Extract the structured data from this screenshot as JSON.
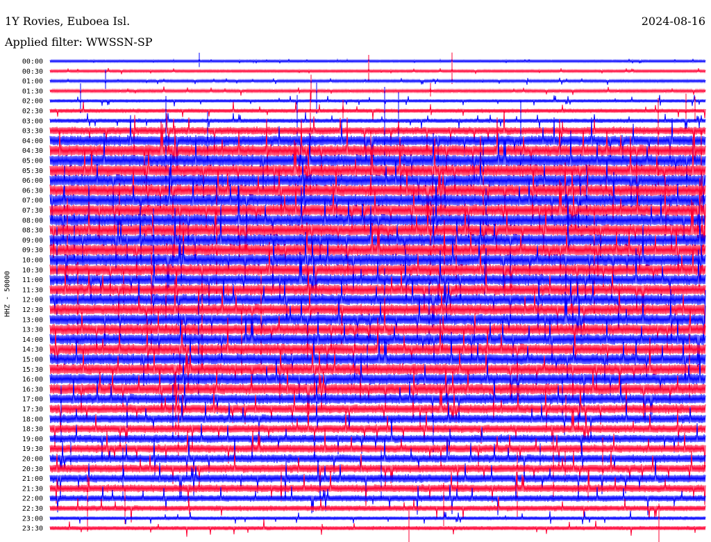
{
  "header": {
    "station": "1Y Rovies, Euboea Isl.",
    "date": "2024-08-16",
    "filter": "Applied filter: WWSSN-SP"
  },
  "chart_data": {
    "type": "helicorder",
    "title": "1Y Rovies, Euboea Isl.",
    "date": "2024-08-16",
    "filter": "WWSSN-SP",
    "ylabel": "HHZ - 50000",
    "row_interval_minutes": 30,
    "series_colors": [
      "#0000ff",
      "#ff0033"
    ],
    "rows": [
      {
        "time": "00:00",
        "level": 0.06
      },
      {
        "time": "00:30",
        "level": 0.08
      },
      {
        "time": "01:00",
        "level": 0.1
      },
      {
        "time": "01:30",
        "level": 0.13
      },
      {
        "time": "02:00",
        "level": 0.18
      },
      {
        "time": "02:30",
        "level": 0.28
      },
      {
        "time": "03:00",
        "level": 0.3
      },
      {
        "time": "03:30",
        "level": 0.7
      },
      {
        "time": "04:00",
        "level": 1.0
      },
      {
        "time": "04:30",
        "level": 1.1
      },
      {
        "time": "05:00",
        "level": 1.15
      },
      {
        "time": "05:30",
        "level": 1.15
      },
      {
        "time": "06:00",
        "level": 1.15
      },
      {
        "time": "06:30",
        "level": 1.15
      },
      {
        "time": "07:00",
        "level": 1.15
      },
      {
        "time": "07:30",
        "level": 1.15
      },
      {
        "time": "08:00",
        "level": 1.15
      },
      {
        "time": "08:30",
        "level": 1.15
      },
      {
        "time": "09:00",
        "level": 1.15
      },
      {
        "time": "09:30",
        "level": 1.15
      },
      {
        "time": "10:00",
        "level": 1.15
      },
      {
        "time": "10:30",
        "level": 1.1
      },
      {
        "time": "11:00",
        "level": 1.05
      },
      {
        "time": "11:30",
        "level": 1.05
      },
      {
        "time": "12:00",
        "level": 1.05
      },
      {
        "time": "12:30",
        "level": 1.05
      },
      {
        "time": "13:00",
        "level": 1.05
      },
      {
        "time": "13:30",
        "level": 1.05
      },
      {
        "time": "14:00",
        "level": 1.05
      },
      {
        "time": "14:30",
        "level": 1.05
      },
      {
        "time": "15:00",
        "level": 1.05
      },
      {
        "time": "15:30",
        "level": 1.05
      },
      {
        "time": "16:00",
        "level": 1.05
      },
      {
        "time": "16:30",
        "level": 1.05
      },
      {
        "time": "17:00",
        "level": 0.95
      },
      {
        "time": "17:30",
        "level": 0.85
      },
      {
        "time": "18:00",
        "level": 0.8
      },
      {
        "time": "18:30",
        "level": 0.75
      },
      {
        "time": "19:00",
        "level": 0.75
      },
      {
        "time": "19:30",
        "level": 0.75
      },
      {
        "time": "20:00",
        "level": 0.75
      },
      {
        "time": "20:30",
        "level": 0.75
      },
      {
        "time": "21:00",
        "level": 0.75
      },
      {
        "time": "21:30",
        "level": 0.7
      },
      {
        "time": "22:00",
        "level": 0.55
      },
      {
        "time": "22:30",
        "level": 0.45
      },
      {
        "time": "23:00",
        "level": 0.22
      },
      {
        "time": "23:30",
        "level": 0.28
      }
    ]
  }
}
